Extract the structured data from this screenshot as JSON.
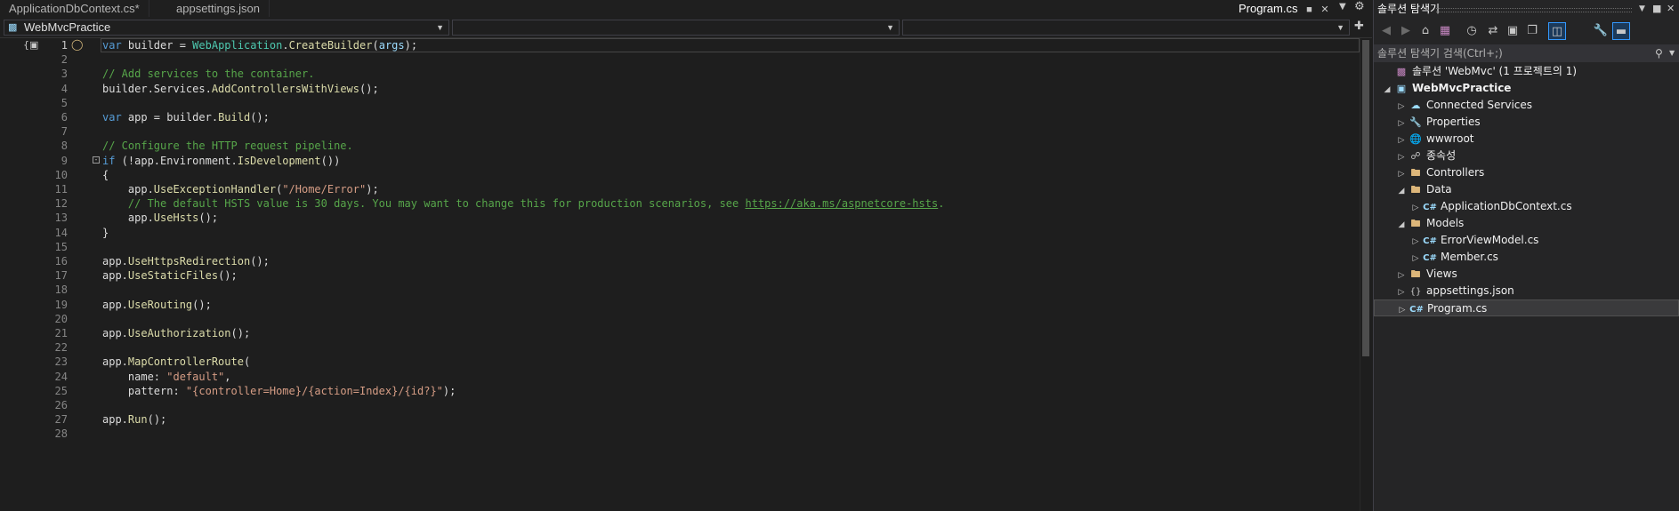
{
  "tabs": {
    "open": [
      {
        "label": "ApplicationDbContext.cs*"
      },
      {
        "label": "appsettings.json"
      }
    ],
    "active": {
      "label": "Program.cs"
    }
  },
  "navbar": {
    "project_dropdown": "WebMvcPractice",
    "type_dropdown": "",
    "member_dropdown": ""
  },
  "editor": {
    "line_numbers": [
      "1",
      "2",
      "3",
      "4",
      "5",
      "6",
      "7",
      "8",
      "9",
      "10",
      "11",
      "12",
      "13",
      "14",
      "15",
      "16",
      "17",
      "18",
      "19",
      "20",
      "21",
      "22",
      "23",
      "24",
      "25",
      "26",
      "27",
      "28"
    ],
    "lines": [
      "var builder = WebApplication.CreateBuilder(args);",
      "",
      "// Add services to the container.",
      "builder.Services.AddControllersWithViews();",
      "",
      "var app = builder.Build();",
      "",
      "// Configure the HTTP request pipeline.",
      "if (!app.Environment.IsDevelopment())",
      "{",
      "    app.UseExceptionHandler(\"/Home/Error\");",
      "    // The default HSTS value is 30 days. You may want to change this for production scenarios, see ",
      "    app.UseHsts();",
      "}",
      "",
      "app.UseHttpsRedirection();",
      "app.UseStaticFiles();",
      "",
      "app.UseRouting();",
      "",
      "app.UseAuthorization();",
      "",
      "app.MapControllerRoute(",
      "    name: \"default\",",
      "    pattern: \"{controller=Home}/{action=Index}/{id?}\");",
      "",
      "app.Run();",
      ""
    ],
    "link_text": "https://aka.ms/aspnetcore-hsts",
    "link_suffix": "."
  },
  "solution_explorer": {
    "title": "솔루션 탐색기",
    "search_placeholder": "솔루션 탐색기 검색(Ctrl+;)",
    "tree": [
      {
        "label": "솔루션 'WebMvc' (1 프로젝트의 1)",
        "icon": "solution-icon"
      },
      {
        "label": "WebMvcPractice",
        "icon": "project-icon"
      },
      {
        "label": "Connected Services",
        "icon": "connected-services-icon"
      },
      {
        "label": "Properties",
        "icon": "properties-icon"
      },
      {
        "label": "wwwroot",
        "icon": "globe-icon"
      },
      {
        "label": "종속성",
        "icon": "dependencies-icon"
      },
      {
        "label": "Controllers",
        "icon": "folder-icon"
      },
      {
        "label": "Data",
        "icon": "folder-icon"
      },
      {
        "label": "ApplicationDbContext.cs",
        "icon": "csharp-file-icon"
      },
      {
        "label": "Models",
        "icon": "folder-icon"
      },
      {
        "label": "ErrorViewModel.cs",
        "icon": "csharp-file-icon"
      },
      {
        "label": "Member.cs",
        "icon": "csharp-file-icon"
      },
      {
        "label": "Views",
        "icon": "folder-icon"
      },
      {
        "label": "appsettings.json",
        "icon": "json-file-icon"
      },
      {
        "label": "Program.cs",
        "icon": "csharp-file-icon"
      }
    ]
  },
  "colors": {
    "keyword": "#569cd6",
    "comment": "#57a64a",
    "string": "#d69d85",
    "accent": "#3399ff"
  }
}
